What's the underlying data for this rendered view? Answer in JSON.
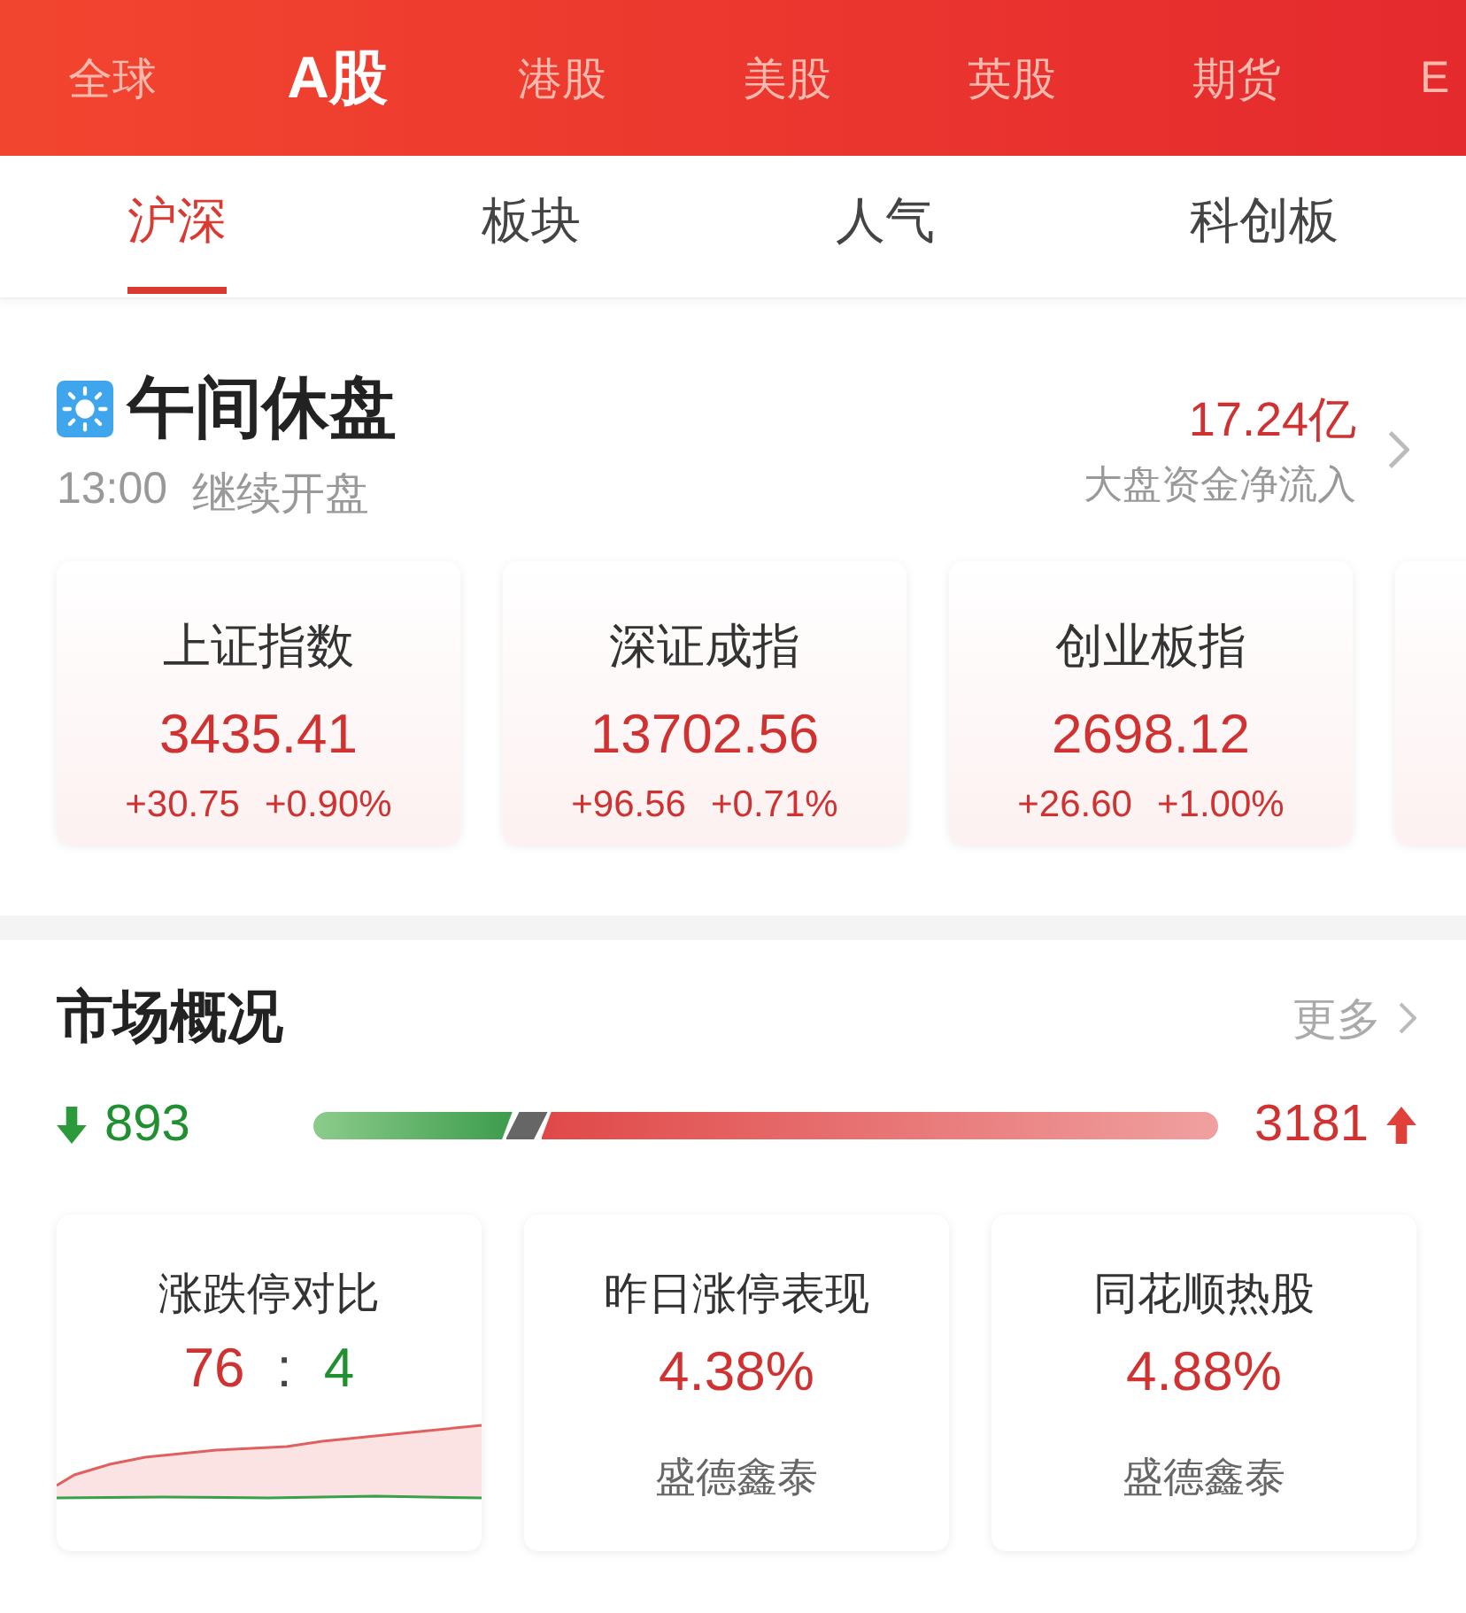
{
  "market_tabs": [
    {
      "label": "全球",
      "selected": false
    },
    {
      "label": "A股",
      "selected": true
    },
    {
      "label": "港股",
      "selected": false
    },
    {
      "label": "美股",
      "selected": false
    },
    {
      "label": "英股",
      "selected": false
    },
    {
      "label": "期货",
      "selected": false
    },
    {
      "label": "E",
      "selected": false
    }
  ],
  "sub_tabs": [
    {
      "label": "沪深",
      "selected": true
    },
    {
      "label": "板块",
      "selected": false
    },
    {
      "label": "人气",
      "selected": false
    },
    {
      "label": "科创板",
      "selected": false
    }
  ],
  "session": {
    "title": "午间休盘",
    "time": "13:00",
    "note": "继续开盘",
    "net_inflow": "17.24亿",
    "net_inflow_label": "大盘资金净流入"
  },
  "indices": [
    {
      "name": "上证指数",
      "value": "3435.41",
      "change": "+30.75",
      "percent": "+0.90%"
    },
    {
      "name": "深证成指",
      "value": "13702.56",
      "change": "+96.56",
      "percent": "+0.71%"
    },
    {
      "name": "创业板指",
      "value": "2698.12",
      "change": "+26.60",
      "percent": "+1.00%"
    }
  ],
  "overview": {
    "title": "市场概况",
    "more": "更多",
    "down_count": "893",
    "up_count": "3181"
  },
  "overview_cards": [
    {
      "kind": "ratio",
      "title": "涨跌停对比",
      "up": "76",
      "separator": ":",
      "down": "4"
    },
    {
      "kind": "stock",
      "title": "昨日涨停表现",
      "value": "4.38%",
      "stock": "盛德鑫泰"
    },
    {
      "kind": "stock",
      "title": "同花顺热股",
      "value": "4.88%",
      "stock": "盛德鑫泰"
    }
  ]
}
